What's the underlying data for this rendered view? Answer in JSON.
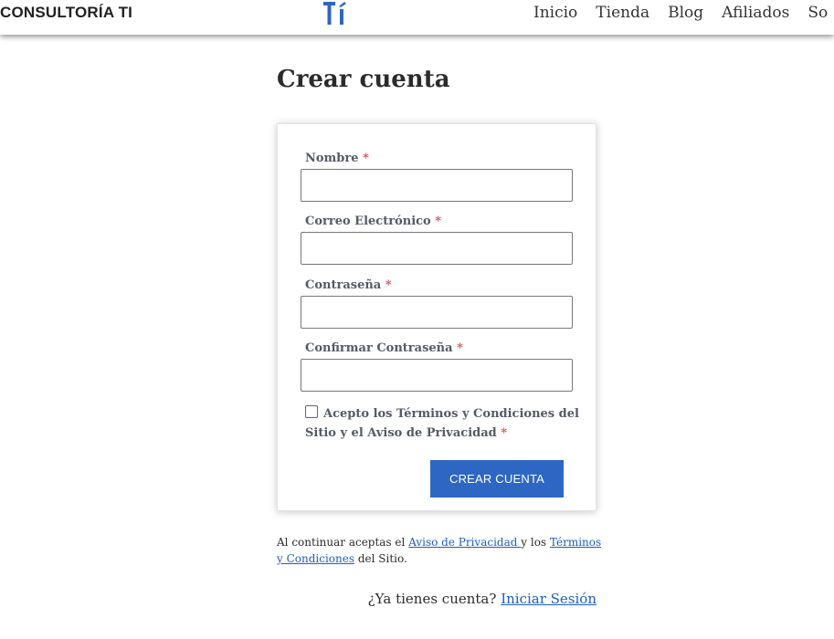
{
  "header": {
    "site_name": "CONSULTORÍA TI",
    "logo_text": "TI",
    "logo_color": "#2e66c4",
    "nav": [
      "Inicio",
      "Tienda",
      "Blog",
      "Afiliados",
      "So"
    ]
  },
  "page": {
    "title": "Crear cuenta"
  },
  "form": {
    "required_mark": "*",
    "fields": [
      {
        "label": "Nombre",
        "value": ""
      },
      {
        "label": "Correo Electrónico",
        "value": ""
      },
      {
        "label": "Contraseña",
        "value": ""
      },
      {
        "label": "Confirmar Contraseña",
        "value": ""
      }
    ],
    "terms_checkbox": {
      "label": "Acepto los Términos y Condiciones del Sitio y el Aviso de Privacidad",
      "checked": false
    },
    "submit_label": "CREAR CUENTA",
    "accent_color": "#2e66c4"
  },
  "footer_note": {
    "prefix": "Al continuar aceptas el ",
    "privacy_link": "Aviso de Privacidad ",
    "middle": "y los ",
    "terms_link": "Términos y Condiciones",
    "suffix": " del Sitio."
  },
  "login": {
    "prompt": "¿Ya tienes cuenta? ",
    "link": "Iniciar Sesión"
  }
}
